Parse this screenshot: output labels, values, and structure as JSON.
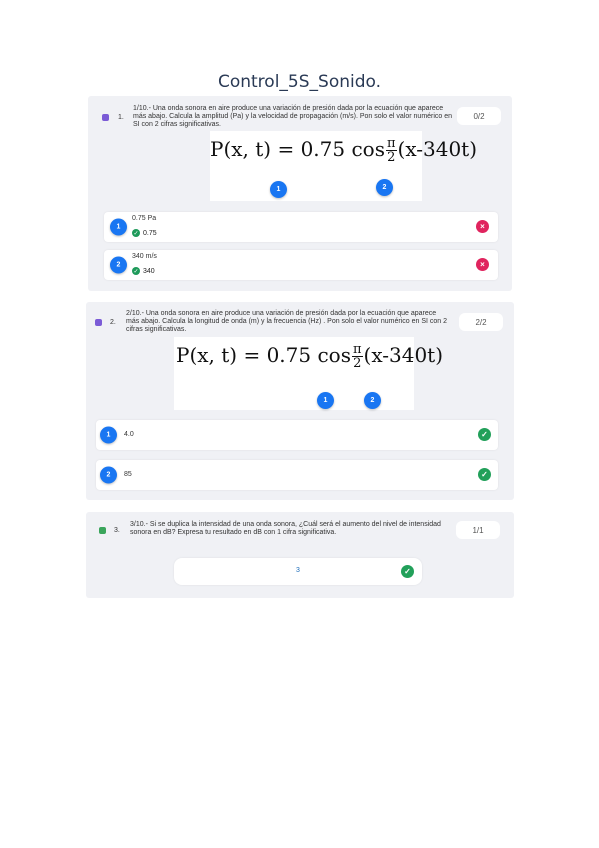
{
  "page": {
    "title": "Control_5S_Sonido."
  },
  "questions": [
    {
      "number": "1.",
      "text": "1/10.- Una onda sonora en aire produce una variación de presión dada por la ecuación que aparece más abajo. Calcula la amplitud (Pa) y la velocidad de propagación (m/s). Pon solo el valor numérico en SI con 2 cifras significativas.",
      "score": "0/2",
      "formula": {
        "lhs": "P(x, t) = 0.75 cos",
        "frac_num": "π",
        "frac_den": "2",
        "rhs": "(x-340t)"
      },
      "markers": [
        "1",
        "2"
      ],
      "answers": [
        {
          "marker": "1",
          "given": "0.75 Pa",
          "correct": "0.75",
          "status": "×"
        },
        {
          "marker": "2",
          "given": "340 m/s",
          "correct": "340",
          "status": "×"
        }
      ]
    },
    {
      "number": "2.",
      "text": "2/10.- Una onda sonora en aire produce una variación de presión dada por la ecuación que aparece más abajo. Calcula la longitud de onda (m) y la frecuencia (Hz) . Pon solo el valor numérico en SI con 2 cifras significativas.",
      "score": "2/2",
      "formula": {
        "lhs": "P(x, t) = 0.75 cos",
        "frac_num": "π",
        "frac_den": "2",
        "rhs": "(x-340t)"
      },
      "markers": [
        "1",
        "2"
      ],
      "answers": [
        {
          "marker": "1",
          "given": "4.0",
          "status": "✓"
        },
        {
          "marker": "2",
          "given": "85",
          "status": "✓"
        }
      ]
    },
    {
      "number": "3.",
      "text": "3/10.- Si se duplica la intensidad de una onda sonora, ¿Cuál será el aumento del nivel de intensidad sonora en dB? Expresa tu resultado en dB con 1 cifra significativa.",
      "score": "1/1",
      "answer": {
        "given": "3",
        "status": "✓"
      }
    }
  ]
}
